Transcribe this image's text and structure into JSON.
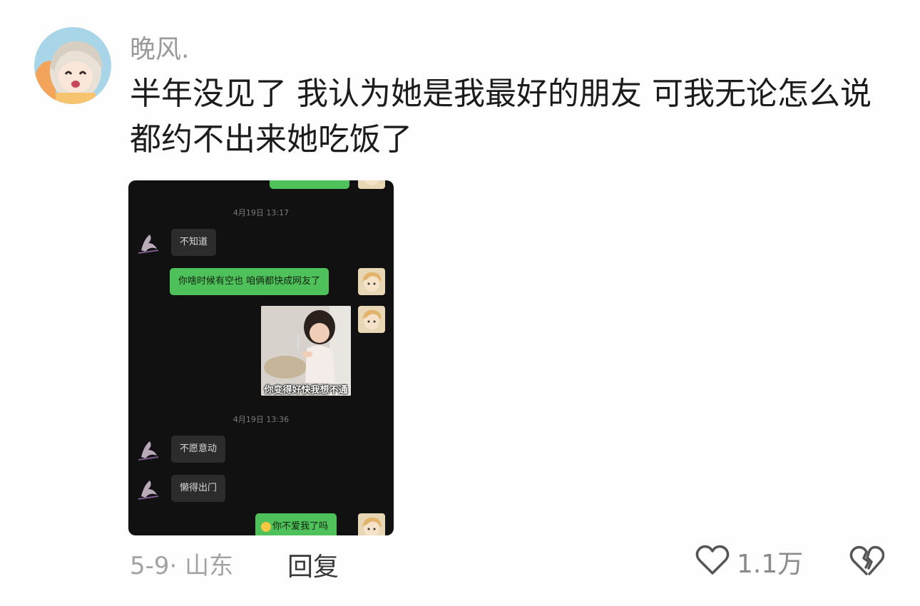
{
  "comment": {
    "username": "晚风.",
    "text": "半年没见了 我认为她是我最好的朋友 可我无论怎么说 都约不出来她吃饭了",
    "meta": "5-9· 山东",
    "reply_label": "回复",
    "like_count": "1.1万"
  },
  "chat": {
    "timestamp_1": "4月19日 13:17",
    "msg_1": "不知道",
    "msg_2": "你啥时候有空也 咱俩都快成网友了",
    "sticker_caption": "你变得好快我想不通",
    "timestamp_2": "4月19日 13:36",
    "msg_3": "不愿意动",
    "msg_4": "懒得出门",
    "msg_5": "你不爱我了吗"
  },
  "icons": {
    "like": "heart-outline-icon",
    "dislike": "broken-heart-icon"
  },
  "colors": {
    "bubble_outgoing": "#4fc15a",
    "bubble_incoming": "#2c2c2c",
    "chat_background": "#111111"
  }
}
